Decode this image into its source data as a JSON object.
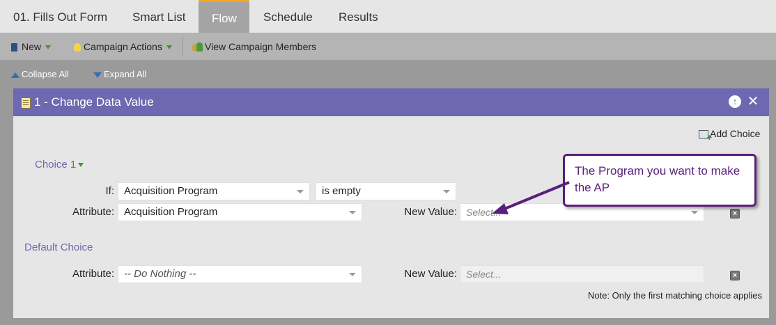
{
  "tabs": [
    {
      "label": "01. Fills Out Form",
      "active": false
    },
    {
      "label": "Smart List",
      "active": false
    },
    {
      "label": "Flow",
      "active": true
    },
    {
      "label": "Schedule",
      "active": false
    },
    {
      "label": "Results",
      "active": false
    }
  ],
  "toolbar": {
    "new_label": "New",
    "campaign_actions_label": "Campaign Actions",
    "view_members_label": "View Campaign Members"
  },
  "collapse": {
    "collapse_label": "Collapse All",
    "expand_label": "Expand All"
  },
  "card": {
    "title": "1 - Change Data Value",
    "add_choice_label": "Add Choice",
    "choice1": {
      "label": "Choice 1",
      "if_label": "If:",
      "if_field": "Acquisition Program",
      "if_operator": "is empty",
      "attribute_label": "Attribute:",
      "attribute_value": "Acquisition Program",
      "new_value_label": "New Value:",
      "new_value_placeholder": "Select..."
    },
    "default_choice": {
      "label": "Default Choice",
      "attribute_label": "Attribute:",
      "attribute_value": "-- Do Nothing --",
      "new_value_label": "New Value:",
      "new_value_placeholder": "Select..."
    },
    "note": "Note: Only the first matching choice applies"
  },
  "callout": {
    "text": "The Program you want to make the AP",
    "color": "#5a1f7a"
  },
  "colors": {
    "header_purple": "#6d68af",
    "active_tab_accent": "#f5a623"
  }
}
